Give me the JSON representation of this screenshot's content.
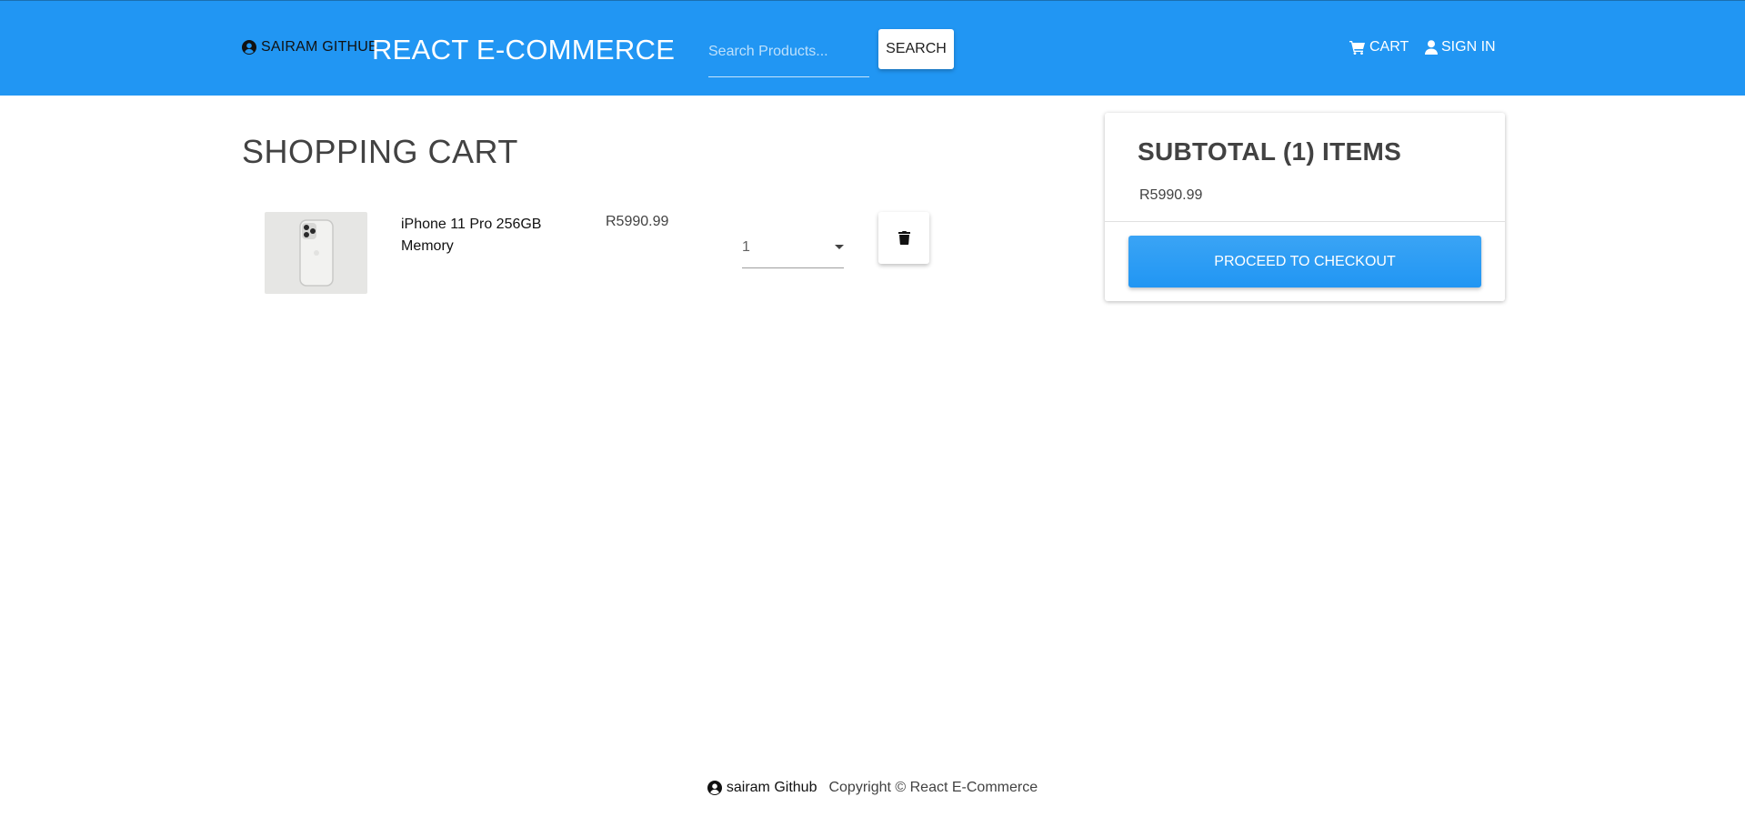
{
  "header": {
    "brand_link": "SAIRAM GITHUB",
    "brand_link_icon": "user-circle-icon",
    "title": "REACT E-COMMERCE",
    "search_placeholder": "Search Products...",
    "search_button": "SEARCH",
    "cart_link": "CART",
    "cart_icon": "shopping-cart-icon",
    "signin_link": "SIGN IN",
    "signin_icon": "user-icon"
  },
  "cart": {
    "title": "SHOPPING CART",
    "items": [
      {
        "name": "iPhone 11 Pro 256GB Memory",
        "price": "R5990.99",
        "quantity": "1",
        "delete_icon": "trash-icon"
      }
    ]
  },
  "summary": {
    "title": "SUBTOTAL (1) ITEMS",
    "amount": "R5990.99",
    "checkout_button": "PROCEED TO CHECKOUT"
  },
  "footer": {
    "link": "sairam Github",
    "copyright": "Copyright © React E-Commerce"
  },
  "colors": {
    "primary": "#2196f3",
    "text": "#424242"
  }
}
